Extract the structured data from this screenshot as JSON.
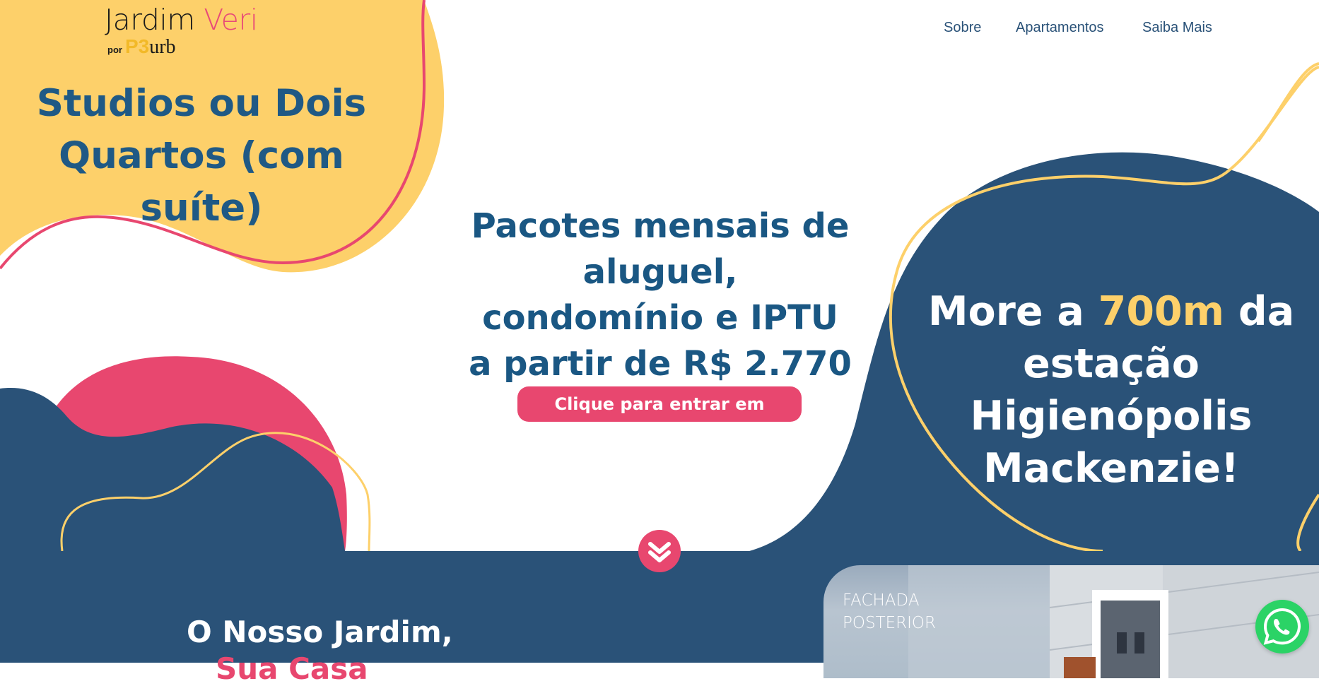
{
  "header": {
    "logo": {
      "name_part1": "Jardim",
      "name_part2": "Veri",
      "by": "por",
      "brand_p3": "P3",
      "brand_urb": "urb"
    },
    "nav": [
      "Sobre",
      "Apartamentos",
      "Saiba Mais"
    ]
  },
  "hero": {
    "title_line1": "Studios ou Dois",
    "title_line2": "Quartos (com suíte)",
    "center_line1": "Pacotes mensais de aluguel,",
    "center_line2": "condomínio e IPTU",
    "center_line3": "a partir de R$ 2.770",
    "cta_label": "Clique para entrar em contato",
    "right_part1": "More a",
    "right_highlight": "700m",
    "right_part2": "da",
    "right_line2": "estação Higienópolis",
    "right_line3": "Mackenzie!",
    "scroll_icon": "chevron-double-down-icon"
  },
  "section": {
    "title": "O Nosso Jardim,",
    "title_line2": "Sua Casa",
    "photo_label_line1": "FACHADA",
    "photo_label_line2": "POSTERIOR"
  },
  "floating": {
    "icon": "whatsapp-icon"
  },
  "colors": {
    "navy": "#2a5278",
    "yellow": "#fdd06a",
    "pink": "#e8476f",
    "dark_text": "#1a5783",
    "whatsapp": "#2bd366"
  }
}
